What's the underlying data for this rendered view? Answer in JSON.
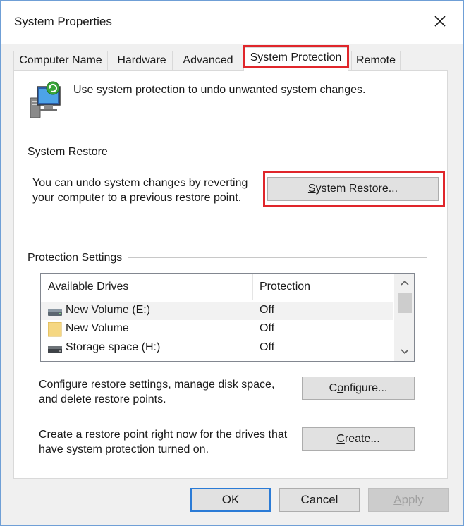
{
  "window": {
    "title": "System Properties"
  },
  "tabs": [
    {
      "label": "Computer Name",
      "active": false
    },
    {
      "label": "Hardware",
      "active": false
    },
    {
      "label": "Advanced",
      "active": false
    },
    {
      "label": "System Protection",
      "active": true
    },
    {
      "label": "Remote",
      "active": false
    }
  ],
  "intro": {
    "text": "Use system protection to undo unwanted system changes.",
    "icon": "system-protection-computer-icon"
  },
  "system_restore": {
    "group_label": "System Restore",
    "description_line1": "You can undo system changes by reverting",
    "description_line2": "your computer to a previous restore point.",
    "button_label": "System Restore...",
    "button_mnemonic": "S",
    "button_rest": "ystem Restore..."
  },
  "protection_settings": {
    "group_label": "Protection Settings",
    "columns": [
      "Available Drives",
      "Protection"
    ],
    "drives": [
      {
        "name": "New Volume (E:)",
        "protection": "Off",
        "icon": "drive-icon",
        "selected": true
      },
      {
        "name": "New Volume",
        "protection": "Off",
        "icon": "folder-icon",
        "selected": false
      },
      {
        "name": "Storage space (H:)",
        "protection": "Off",
        "icon": "drive-icon",
        "selected": false
      }
    ],
    "configure_text_line1": "Configure restore settings, manage disk space,",
    "configure_text_line2": "and delete restore points.",
    "configure_label": "Configure...",
    "configure_mnemonic": "o",
    "configure_pre": "C",
    "configure_post": "nfigure...",
    "create_text_line1": "Create a restore point right now for the drives that",
    "create_text_line2": "have system protection turned on.",
    "create_label": "Create...",
    "create_mnemonic": "C",
    "create_post": "reate..."
  },
  "footer": {
    "ok_label": "OK",
    "cancel_label": "Cancel",
    "apply_label": "Apply",
    "apply_mnemonic": "A",
    "apply_post": "pply"
  },
  "colors": {
    "highlight": "#e0262b",
    "focus_border": "#2b7bd6",
    "window_border": "#6f9fd6"
  }
}
